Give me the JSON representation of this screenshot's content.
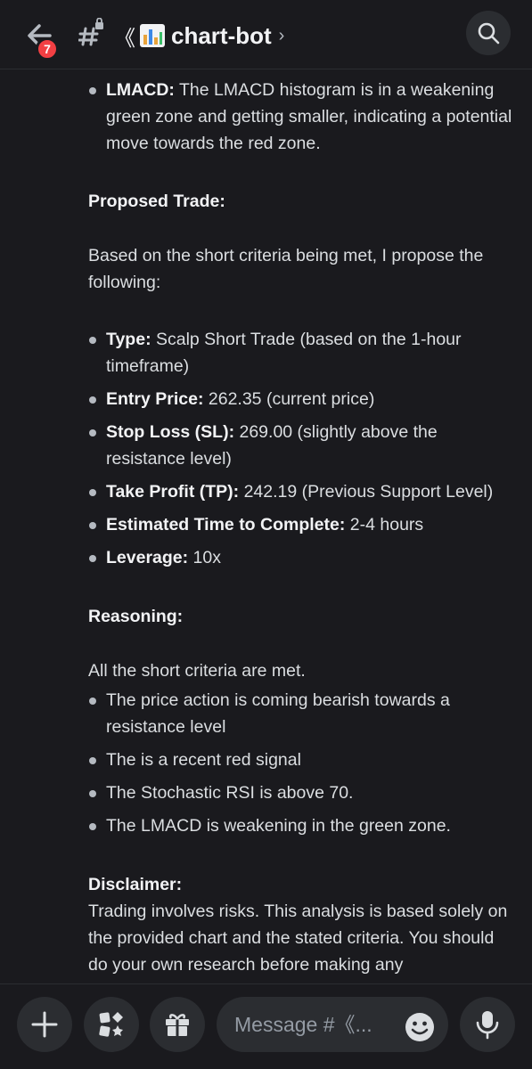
{
  "header": {
    "unread_count": "7",
    "bracket": "《",
    "channel_name": "chart-bot",
    "chevron": "›",
    "icons": [
      "back-arrow-icon",
      "hash-lock-icon",
      "bar-chart-emoji-icon",
      "search-icon"
    ]
  },
  "message": {
    "top_bullet": {
      "label": "LMACD:",
      "text": " The LMACD histogram is in a weakening green zone and getting smaller, indicating a potential move towards the red zone."
    },
    "proposed_heading": "Proposed Trade:",
    "proposed_intro": "Based on the short criteria being met, I propose the following:",
    "trade_items": [
      {
        "label": "Type:",
        "text": " Scalp Short Trade (based on the 1-hour timeframe)"
      },
      {
        "label": "Entry Price:",
        "text": " 262.35 (current price)"
      },
      {
        "label": "Stop Loss (SL):",
        "text": " 269.00 (slightly above the resistance level)"
      },
      {
        "label": "Take Profit (TP):",
        "text": " 242.19 (Previous Support Level)"
      },
      {
        "label": "Estimated Time to Complete:",
        "text": " 2-4 hours"
      },
      {
        "label": "Leverage:",
        "text": " 10x"
      }
    ],
    "reasoning_heading": "Reasoning:",
    "reasoning_intro": "All the short criteria are met.",
    "reasoning_items": [
      "The price action is coming bearish towards a resistance level",
      "The is a recent red signal",
      "The Stochastic RSI is above 70.",
      "The LMACD is weakening in the green zone."
    ],
    "disclaimer_heading": "Disclaimer:",
    "disclaimer_text": "Trading involves risks. This analysis is based solely on the provided chart and the stated criteria. You should do your own research before making any"
  },
  "composer": {
    "placeholder": "Message #《...",
    "icons": [
      "plus-icon",
      "apps-icon",
      "gift-icon",
      "emoji-icon",
      "microphone-icon"
    ]
  },
  "colors": {
    "background": "#1a1a1e",
    "surface": "#2b2d31",
    "badge_red": "#f23f43",
    "text": "#dbdee1"
  }
}
